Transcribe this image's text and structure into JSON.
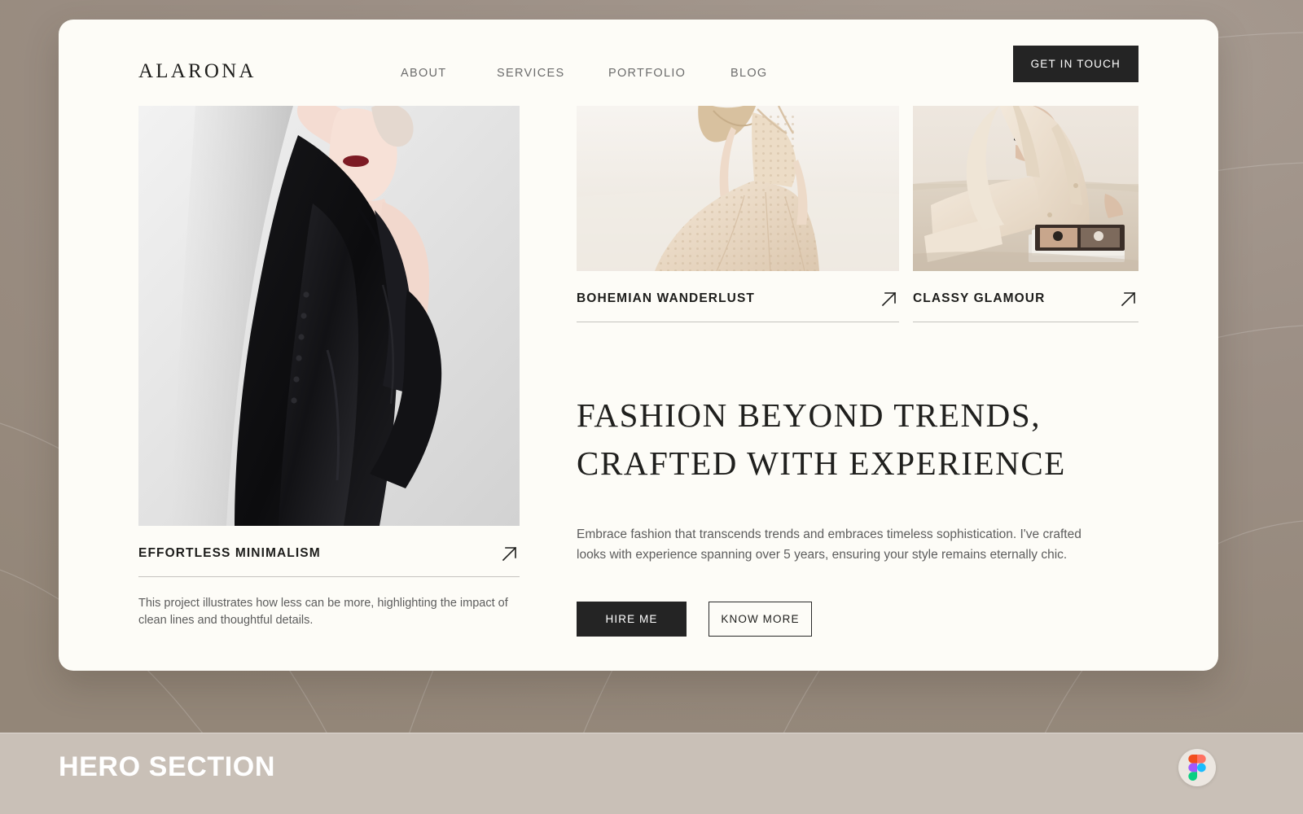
{
  "background": {
    "color": "#9d9187",
    "band_color": "#c9c0b7"
  },
  "annotation": {
    "label": "HERO SECTION",
    "badge_icon": "figma-icon"
  },
  "site": {
    "card_background": "#FDFCF7",
    "header": {
      "logo": "ALARONA",
      "nav": [
        {
          "label": "ABOUT"
        },
        {
          "label": "SERVICES"
        },
        {
          "label": "PORTFOLIO"
        },
        {
          "label": "BLOG"
        }
      ],
      "cta": {
        "label": "GET IN TOUCH",
        "background": "#242424",
        "color": "#ffffff"
      }
    },
    "projects": {
      "main": {
        "title": "EFFORTLESS MINIMALISM",
        "description": "This project illustrates how less can be more, highlighting the impact of clean lines and thoughtful details.",
        "arrow_icon": "arrow-up-right-icon",
        "image_alt": "Model in long black coat leaning against a white wall"
      },
      "secondary": [
        {
          "title": "BOHEMIAN WANDERLUST",
          "arrow_icon": "arrow-up-right-icon",
          "image_alt": "Model twirling in an ivory lace gown"
        },
        {
          "title": "CLASSY GLAMOUR",
          "arrow_icon": "arrow-up-right-icon",
          "image_alt": "Model seated in a cream suit beside magazines"
        }
      ]
    },
    "hero": {
      "heading_line1": "FASHION BEYOND TRENDS,",
      "heading_line2": "CRAFTED WITH EXPERIENCE",
      "paragraph": "Embrace fashion that transcends trends and embraces timeless sophistication. I've crafted looks with experience spanning over 5 years, ensuring your style remains eternally chic.",
      "primary_button": "HIRE ME",
      "secondary_button": "KNOW MORE"
    }
  }
}
